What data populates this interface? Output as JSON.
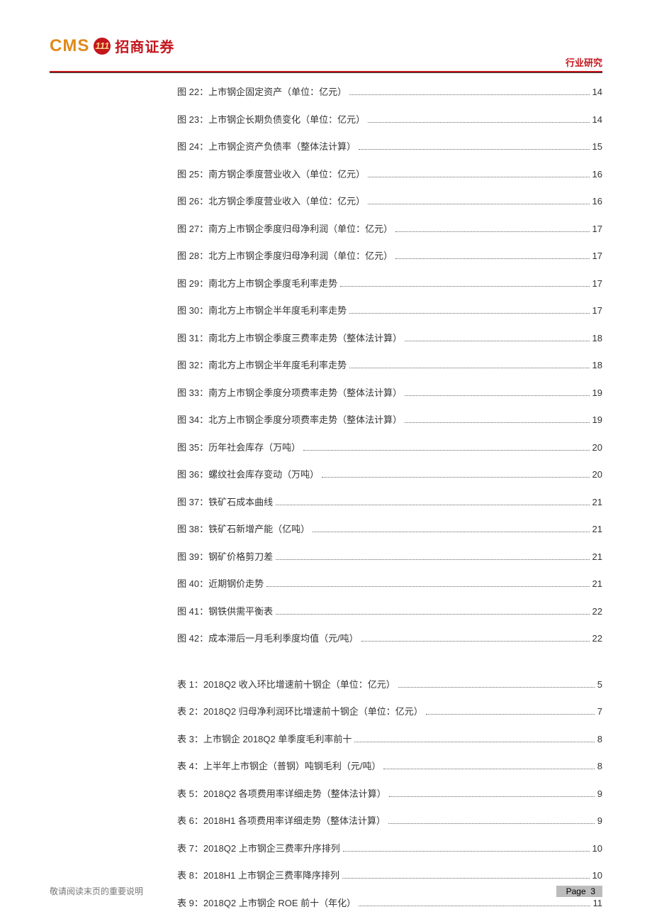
{
  "brand": {
    "cms": "CMS",
    "badge": "111",
    "cn": "招商证券"
  },
  "header_right": "行业研究",
  "figures": [
    {
      "label": "图 22：上市钢企固定资产（单位：亿元）",
      "page": "14"
    },
    {
      "label": "图 23：上市钢企长期负债变化（单位：亿元）",
      "page": "14"
    },
    {
      "label": "图 24：上市钢企资产负债率（整体法计算）",
      "page": "15"
    },
    {
      "label": "图 25：南方钢企季度营业收入（单位：亿元）",
      "page": "16"
    },
    {
      "label": "图 26：北方钢企季度营业收入（单位：亿元）",
      "page": "16"
    },
    {
      "label": "图 27：南方上市钢企季度归母净利润（单位：亿元）",
      "page": "17"
    },
    {
      "label": "图 28：北方上市钢企季度归母净利润（单位：亿元）",
      "page": "17"
    },
    {
      "label": "图 29：南北方上市钢企季度毛利率走势",
      "page": "17"
    },
    {
      "label": "图 30：南北方上市钢企半年度毛利率走势",
      "page": "17"
    },
    {
      "label": "图 31：南北方上市钢企季度三费率走势（整体法计算）",
      "page": "18"
    },
    {
      "label": "图 32：南北方上市钢企半年度毛利率走势",
      "page": "18"
    },
    {
      "label": "图 33：南方上市钢企季度分项费率走势（整体法计算）",
      "page": "19"
    },
    {
      "label": "图 34：北方上市钢企季度分项费率走势（整体法计算）",
      "page": "19"
    },
    {
      "label": "图 35：历年社会库存（万吨）",
      "page": "20"
    },
    {
      "label": "图 36：螺纹社会库存变动（万吨）",
      "page": "20"
    },
    {
      "label": "图 37：铁矿石成本曲线",
      "page": "21"
    },
    {
      "label": "图 38：铁矿石新增产能（亿吨）",
      "page": "21"
    },
    {
      "label": "图 39：钢矿价格剪刀差",
      "page": "21"
    },
    {
      "label": "图 40：近期钢价走势",
      "page": "21"
    },
    {
      "label": "图 41：钢铁供需平衡表",
      "page": "22"
    },
    {
      "label": "图 42：成本滞后一月毛利季度均值（元/吨）",
      "page": "22"
    }
  ],
  "tables": [
    {
      "label": "表 1：2018Q2 收入环比增速前十钢企（单位：亿元）",
      "page": "5"
    },
    {
      "label": "表 2：2018Q2 归母净利润环比增速前十钢企（单位：亿元）",
      "page": "7"
    },
    {
      "label": "表 3：上市钢企 2018Q2 单季度毛利率前十",
      "page": "8"
    },
    {
      "label": "表 4：上半年上市钢企（普钢）吨钢毛利（元/吨）",
      "page": "8"
    },
    {
      "label": "表 5：2018Q2 各项费用率详细走势（整体法计算）",
      "page": "9"
    },
    {
      "label": "表 6：2018H1 各项费用率详细走势（整体法计算）",
      "page": "9"
    },
    {
      "label": "表 7：2018Q2 上市钢企三费率升序排列",
      "page": "10"
    },
    {
      "label": "表 8：2018H1 上市钢企三费率降序排列",
      "page": "10"
    },
    {
      "label": "表 9：2018Q2 上市钢企 ROE 前十（年化）",
      "page": "11"
    }
  ],
  "footer": {
    "left": "敬请阅读末页的重要说明",
    "right_prefix": "Page",
    "right_num": "3"
  }
}
